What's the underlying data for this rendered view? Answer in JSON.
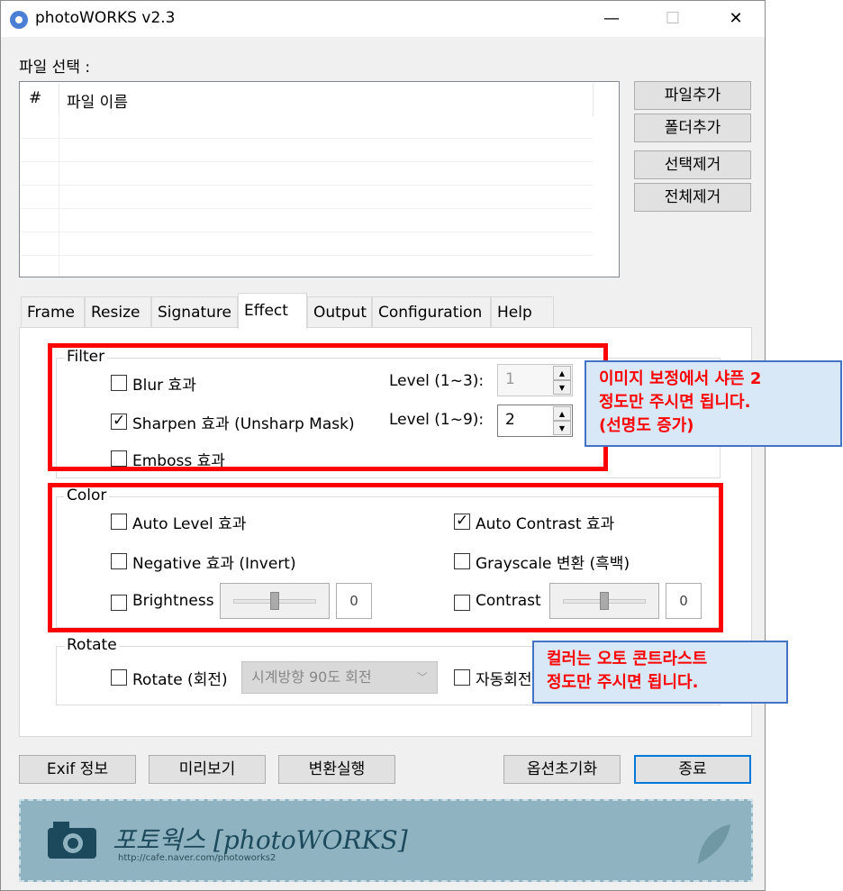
{
  "window": {
    "title": "photoWORKS v2.3",
    "controls": {
      "minimize": "—",
      "maximize": "☐",
      "close": "✕"
    }
  },
  "file_section": {
    "label": "파일 선택 :",
    "columns": [
      "#",
      "파일 이름"
    ],
    "buttons": {
      "add_file": "파일추가",
      "add_folder": "폴더추가",
      "remove_selected": "선택제거",
      "remove_all": "전체제거"
    }
  },
  "tabs": [
    {
      "label": "Frame"
    },
    {
      "label": "Resize"
    },
    {
      "label": "Signature"
    },
    {
      "label": "Effect",
      "active": true
    },
    {
      "label": "Output"
    },
    {
      "label": "Configuration"
    },
    {
      "label": "Help"
    }
  ],
  "filter": {
    "title": "Filter",
    "blur": {
      "label": "Blur 효과",
      "checked": false,
      "level_label": "Level (1~3):",
      "level_value": "1"
    },
    "sharpen": {
      "label": "Sharpen 효과 (Unsharp Mask)",
      "checked": true,
      "level_label": "Level (1~9):",
      "level_value": "2"
    },
    "emboss": {
      "label": "Emboss 효과",
      "checked": false
    }
  },
  "color": {
    "title": "Color",
    "auto_level": {
      "label": "Auto Level 효과",
      "checked": false
    },
    "auto_contrast": {
      "label": "Auto Contrast 효과",
      "checked": true
    },
    "negative": {
      "label": "Negative 효과 (Invert)",
      "checked": false
    },
    "grayscale": {
      "label": "Grayscale 변환 (흑백)",
      "checked": false
    },
    "brightness": {
      "label": "Brightness",
      "checked": false,
      "value": "0",
      "slider_fraction": 0.5
    },
    "contrast": {
      "label": "Contrast",
      "checked": false,
      "value": "0",
      "slider_fraction": 0.5
    }
  },
  "rotate": {
    "title": "Rotate",
    "rotate_label": "Rotate (회전)",
    "direction": "시계방향 90도 회전",
    "auto_label": "자동회전"
  },
  "bottom_buttons": {
    "exif": "Exif 정보",
    "preview": "미리보기",
    "convert": "변환실행",
    "reset": "옵션초기화",
    "exit": "종료"
  },
  "banner": {
    "title": "포토웍스 [photoWORKS]",
    "url": "http://cafe.naver.com/photoworks2"
  },
  "annotations": {
    "filter_note": [
      "이미지 보정에서 샤픈 2",
      "정도만 주시면 됩니다.",
      "(선명도 증가)"
    ],
    "color_note": [
      "컬러는 오토 콘트라스트",
      "정도만 주시면 됩니다."
    ]
  },
  "colors": {
    "highlight": "#ff0000",
    "callout_bg": "#d9e8f7",
    "callout_border": "#4472c4",
    "accent": "#0078d7"
  }
}
